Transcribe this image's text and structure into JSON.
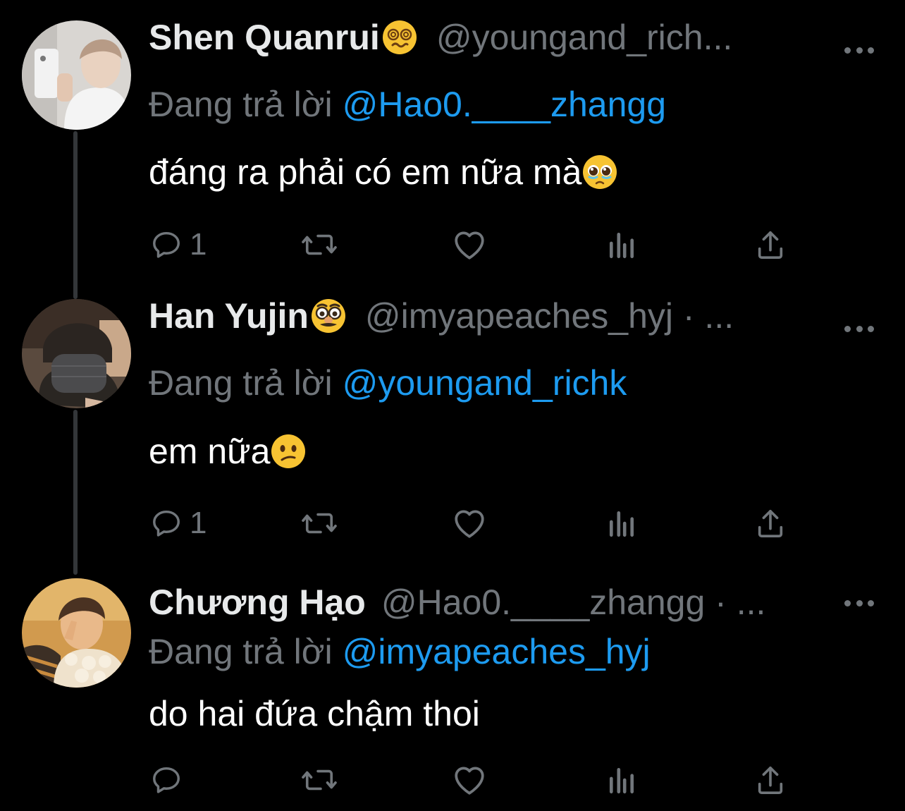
{
  "reply_prefix": "Đang trả lời",
  "tweets": [
    {
      "name": "Shen Quanrui",
      "emoji": "dizzy-face",
      "handle": "@youngand_rich...",
      "reply_to": "@Hao0.____zhangg",
      "text": "đáng ra phải có em nữa mà",
      "text_emoji": "pleading-face",
      "reply_count": "1"
    },
    {
      "name": "Han Yujin",
      "emoji": "disguised-face",
      "handle": "@imyapeaches_hyj · ...",
      "reply_to": "@youngand_richk",
      "text": "em nữa",
      "text_emoji": "confused-face",
      "reply_count": "1"
    },
    {
      "name": "Chương Hạo",
      "emoji": "",
      "handle": "@Hao0.____zhangg · ...",
      "reply_to": "@imyapeaches_hyj",
      "text": "do hai đứa chậm thoi",
      "text_emoji": "",
      "reply_count": ""
    }
  ],
  "colors": {
    "background": "#000000",
    "text": "#e7e9ea",
    "secondary": "#71767b",
    "accent": "#1d9bf0",
    "thread_line": "#333639"
  },
  "icons": [
    "reply-icon",
    "retweet-icon",
    "like-icon",
    "views-icon",
    "share-icon",
    "more-icon"
  ]
}
